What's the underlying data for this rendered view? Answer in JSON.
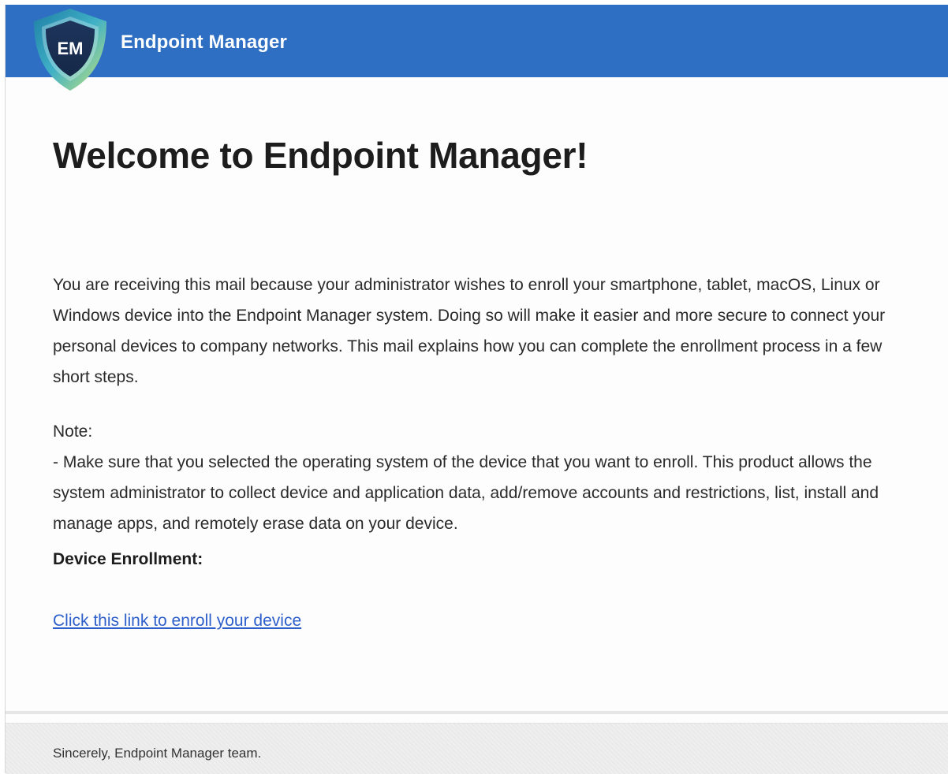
{
  "header": {
    "logo_text": "EM",
    "brand_name": "Endpoint Manager"
  },
  "email": {
    "title": "Welcome to Endpoint Manager!",
    "intro": "You are receiving this mail because your administrator wishes to enroll your smartphone, tablet, macOS, Linux or Windows device into the Endpoint Manager system. Doing so will make it easier and more secure to connect your personal devices to company networks. This mail explains how you can complete the enrollment process in a few short steps.",
    "note_label": "Note:",
    "note_text": "- Make sure that you selected the operating system of the device that you want to enroll. This product allows the system administrator to collect device and application data, add/remove accounts and restrictions, list, install and manage apps, and remotely erase data on your device.",
    "enrollment_heading": "Device Enrollment:",
    "enrollment_link": "Click this link to enroll your device"
  },
  "footer": {
    "signature": "Sincerely, Endpoint Manager team."
  },
  "colors": {
    "header_bg": "#2f6fc3",
    "link": "#2d5fcb",
    "footer_bg": "#efefef"
  },
  "icons": {
    "logo": "shield-logo-icon"
  }
}
